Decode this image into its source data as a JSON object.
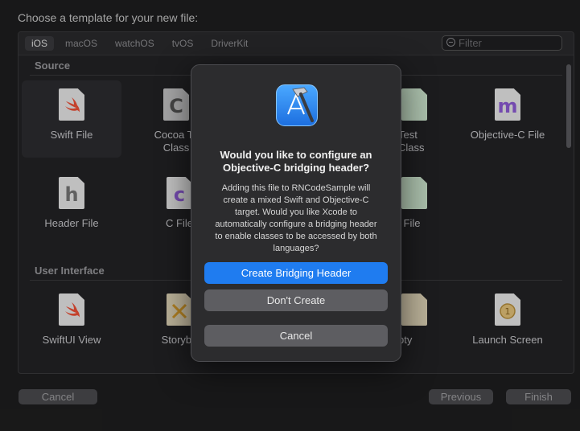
{
  "header": {
    "title": "Choose a template for your new file:"
  },
  "platform_tabs": [
    {
      "label": "iOS",
      "active": true
    },
    {
      "label": "macOS",
      "active": false
    },
    {
      "label": "watchOS",
      "active": false
    },
    {
      "label": "tvOS",
      "active": false
    },
    {
      "label": "DriverKit",
      "active": false
    }
  ],
  "filter": {
    "placeholder": "Filter"
  },
  "sections": {
    "source": "Source",
    "user_interface": "User Interface"
  },
  "templates": {
    "swift_file": {
      "label": "Swift File",
      "glyph": "",
      "icon": "swift-icon",
      "selected": true
    },
    "cocoa_touch": {
      "label": "Cocoa Te\nClass",
      "glyph": "C"
    },
    "unit_test": {
      "label": "Test\nClass"
    },
    "objc_file": {
      "label": "Objective-C File",
      "glyph": "m"
    },
    "header_file": {
      "label": "Header File",
      "glyph": "h"
    },
    "c_file": {
      "label": "C File",
      "glyph": "c"
    },
    "other_file": {
      "label": "l File"
    },
    "swiftui_view": {
      "label": "SwiftUI View"
    },
    "storyboard": {
      "label": "Storybo"
    },
    "empty": {
      "label": "pty"
    },
    "launch_screen": {
      "label": "Launch Screen"
    }
  },
  "footer": {
    "cancel": "Cancel",
    "previous": "Previous",
    "finish": "Finish"
  },
  "alert": {
    "icon": "xcode-icon",
    "title": "Would you like to configure an Objective-C bridging header?",
    "message": "Adding this file to RNCodeSample will create a mixed Swift and Objective-C target. Would you like Xcode to automatically configure a bridging header to enable classes to be accessed by both languages?",
    "primary": "Create Bridging Header",
    "secondary": "Don't Create",
    "cancel": "Cancel"
  },
  "colors": {
    "accent": "#1f7cf0",
    "swift": "#f05138",
    "c_purple": "#8e5bd6"
  }
}
